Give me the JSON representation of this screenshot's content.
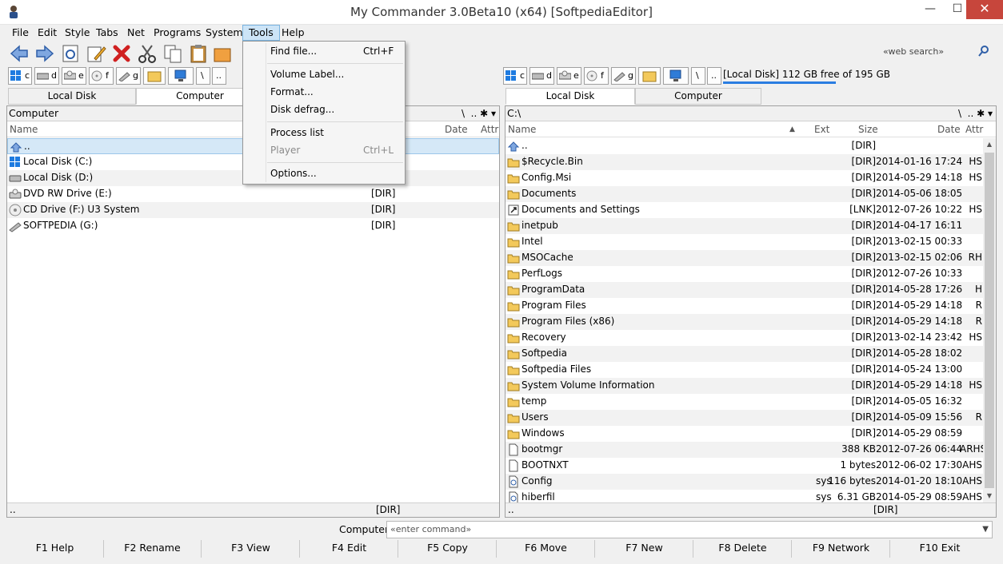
{
  "window": {
    "title": "My Commander 3.0Beta10 (x64) [SoftpediaEditor]",
    "min": "—",
    "max": "☐",
    "close": "✕"
  },
  "menu": [
    "File",
    "Edit",
    "Style",
    "Tabs",
    "Net",
    "Programs",
    "System",
    "Tools",
    "Help"
  ],
  "tools_menu": {
    "items": [
      {
        "label": "Find file...",
        "shortcut": "Ctrl+F",
        "enabled": true
      },
      {
        "label": "Volume Label...",
        "shortcut": "",
        "enabled": true
      },
      {
        "label": "Format...",
        "shortcut": "",
        "enabled": true
      },
      {
        "label": "Disk defrag...",
        "shortcut": "",
        "enabled": true
      },
      {
        "label": "Process list",
        "shortcut": "",
        "enabled": true
      },
      {
        "label": "Player",
        "shortcut": "Ctrl+L",
        "enabled": false
      },
      {
        "label": "Options...",
        "shortcut": "",
        "enabled": true
      }
    ]
  },
  "search": {
    "placeholder": "«web search»"
  },
  "drives": [
    "c",
    "d",
    "e",
    "f",
    "g",
    "\\",
    ".."
  ],
  "right_disk_info": "[Local Disk] 112 GB free of 195 GB",
  "left": {
    "tabs": [
      "Local Disk",
      "Computer"
    ],
    "selected_tab": 1,
    "path": "Computer",
    "columns": {
      "name": "Name",
      "date": "Date",
      "attr": "Attr"
    },
    "rows": [
      {
        "icon": "up-folder-icon",
        "name": "..",
        "size": ""
      },
      {
        "icon": "windows-disk-icon",
        "name": "Local Disk (C:)",
        "size": ""
      },
      {
        "icon": "disk-icon",
        "name": "Local Disk (D:)",
        "size": ""
      },
      {
        "icon": "dvd-drive-icon",
        "name": "DVD RW Drive (E:)",
        "size": "[DIR]"
      },
      {
        "icon": "cd-drive-icon",
        "name": "CD Drive (F:) U3 System",
        "size": "[DIR]"
      },
      {
        "icon": "usb-drive-icon",
        "name": "SOFTPEDIA (G:)",
        "size": "[DIR]"
      }
    ],
    "status_name": "..",
    "status_size": "[DIR]"
  },
  "right": {
    "tabs": [
      "Local Disk",
      "Computer"
    ],
    "selected_tab": 0,
    "path": "C:\\",
    "columns": {
      "name": "Name",
      "ext": "Ext",
      "size": "Size",
      "date": "Date",
      "attr": "Attr"
    },
    "rows": [
      {
        "icon": "up-folder-icon",
        "name": "..",
        "ext": "",
        "size": "[DIR]",
        "date": "",
        "attr": ""
      },
      {
        "icon": "folder-icon",
        "name": "$Recycle.Bin",
        "ext": "",
        "size": "[DIR]",
        "date": "2014-01-16 17:24",
        "attr": "HS"
      },
      {
        "icon": "folder-icon",
        "name": "Config.Msi",
        "ext": "",
        "size": "[DIR]",
        "date": "2014-05-29 14:18",
        "attr": "HS"
      },
      {
        "icon": "folder-icon",
        "name": "Documents",
        "ext": "",
        "size": "[DIR]",
        "date": "2014-05-06 18:05",
        "attr": ""
      },
      {
        "icon": "link-folder-icon",
        "name": "Documents and Settings",
        "ext": "",
        "size": "[LNK]",
        "date": "2012-07-26 10:22",
        "attr": "HS"
      },
      {
        "icon": "folder-icon",
        "name": "inetpub",
        "ext": "",
        "size": "[DIR]",
        "date": "2014-04-17 16:11",
        "attr": ""
      },
      {
        "icon": "folder-icon",
        "name": "Intel",
        "ext": "",
        "size": "[DIR]",
        "date": "2013-02-15 00:33",
        "attr": ""
      },
      {
        "icon": "folder-icon",
        "name": "MSOCache",
        "ext": "",
        "size": "[DIR]",
        "date": "2013-02-15 02:06",
        "attr": "RH"
      },
      {
        "icon": "folder-icon",
        "name": "PerfLogs",
        "ext": "",
        "size": "[DIR]",
        "date": "2012-07-26 10:33",
        "attr": ""
      },
      {
        "icon": "folder-icon",
        "name": "ProgramData",
        "ext": "",
        "size": "[DIR]",
        "date": "2014-05-28 17:26",
        "attr": "H"
      },
      {
        "icon": "folder-icon",
        "name": "Program Files",
        "ext": "",
        "size": "[DIR]",
        "date": "2014-05-29 14:18",
        "attr": "R"
      },
      {
        "icon": "folder-icon",
        "name": "Program Files (x86)",
        "ext": "",
        "size": "[DIR]",
        "date": "2014-05-29 14:18",
        "attr": "R"
      },
      {
        "icon": "folder-icon",
        "name": "Recovery",
        "ext": "",
        "size": "[DIR]",
        "date": "2013-02-14 23:42",
        "attr": "HS"
      },
      {
        "icon": "folder-icon",
        "name": "Softpedia",
        "ext": "",
        "size": "[DIR]",
        "date": "2014-05-28 18:02",
        "attr": ""
      },
      {
        "icon": "folder-icon",
        "name": "Softpedia Files",
        "ext": "",
        "size": "[DIR]",
        "date": "2014-05-24 13:00",
        "attr": ""
      },
      {
        "icon": "folder-icon",
        "name": "System Volume Information",
        "ext": "",
        "size": "[DIR]",
        "date": "2014-05-29 14:18",
        "attr": "HS"
      },
      {
        "icon": "folder-icon",
        "name": "temp",
        "ext": "",
        "size": "[DIR]",
        "date": "2014-05-05 16:32",
        "attr": ""
      },
      {
        "icon": "folder-icon",
        "name": "Users",
        "ext": "",
        "size": "[DIR]",
        "date": "2014-05-09 15:56",
        "attr": "R"
      },
      {
        "icon": "folder-icon",
        "name": "Windows",
        "ext": "",
        "size": "[DIR]",
        "date": "2014-05-29 08:59",
        "attr": ""
      },
      {
        "icon": "file-icon",
        "name": "bootmgr",
        "ext": "",
        "size": "388 KB",
        "date": "2012-07-26 06:44",
        "attr": "ARHS"
      },
      {
        "icon": "file-icon",
        "name": "BOOTNXT",
        "ext": "",
        "size": "1 bytes",
        "date": "2012-06-02 17:30",
        "attr": "AHS"
      },
      {
        "icon": "system-file-icon",
        "name": "Config",
        "ext": "sys",
        "size": "116 bytes",
        "date": "2014-01-20 18:10",
        "attr": "AHS"
      },
      {
        "icon": "system-file-icon",
        "name": "hiberfil",
        "ext": "sys",
        "size": "6.31 GB",
        "date": "2014-05-29 08:59",
        "attr": "AHS"
      }
    ],
    "status_name": "..",
    "status_size": "[DIR]"
  },
  "command": {
    "label": "Computer",
    "placeholder": "«enter command»"
  },
  "fkeys": [
    "F1 Help",
    "F2 Rename",
    "F3 View",
    "F4 Edit",
    "F5 Copy",
    "F6 Move",
    "F7 New",
    "F8 Delete",
    "F9 Network",
    "F10 Exit"
  ]
}
